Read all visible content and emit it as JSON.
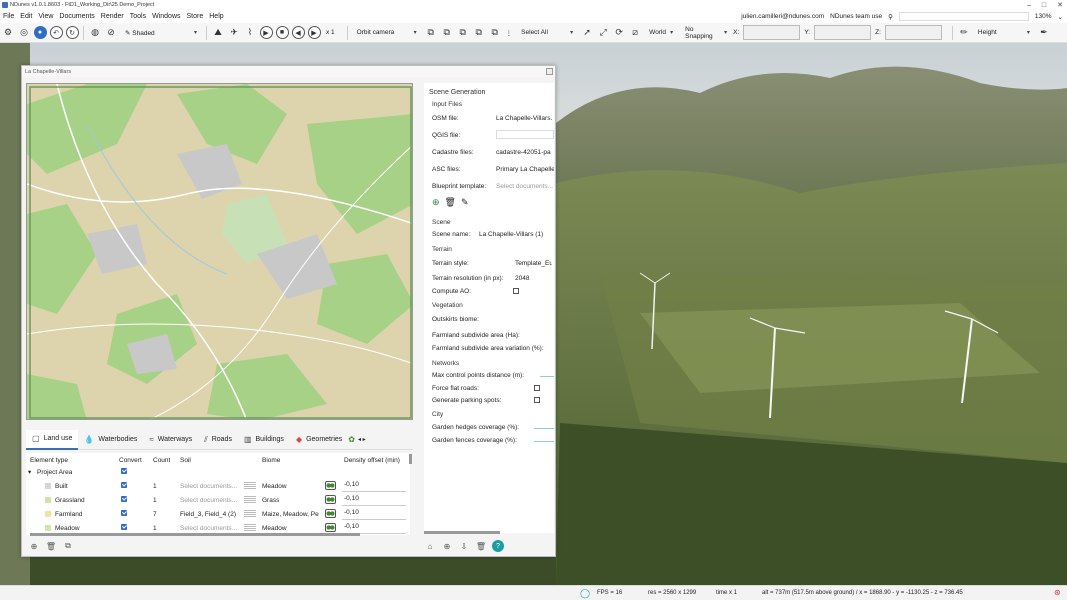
{
  "titlebar": {
    "title": "NDunes v1.0.1.8603 - FtD1_Working_Dir\\25 Demo_Project"
  },
  "menu": {
    "items": [
      "File",
      "Edit",
      "View",
      "Documents",
      "Render",
      "Tools",
      "Windows",
      "Store",
      "Help"
    ],
    "user": "julien.camilleri@ndunes.com",
    "license": "NDunes team use",
    "zoom": "130%"
  },
  "toolbar": {
    "shading": "Shaded",
    "speed": "x 1",
    "camera": "Orbit camera",
    "selection": "Select All",
    "space": "World",
    "snapping": "No Snapping",
    "x_label": "X:",
    "y_label": "Y:",
    "z_label": "Z:",
    "brush": "Height"
  },
  "panel": {
    "title": "La Chapelle-Villars",
    "tabs": [
      "Land use",
      "Waterbodies",
      "Waterways",
      "Roads",
      "Buildings",
      "Geometries"
    ],
    "table": {
      "headers": [
        "Element type",
        "Convert",
        "Count",
        "Soil",
        "Biome",
        "Density offset (min)"
      ],
      "group": "Project Area",
      "rows": [
        {
          "name": "Built",
          "color": "#d6d6d6",
          "count": "1",
          "soil": "Select documents...",
          "biome": "Meadow",
          "density": "-0,10"
        },
        {
          "name": "Grassland",
          "color": "#c9e6a6",
          "count": "1",
          "soil": "Select documents...",
          "biome": "Grass",
          "density": "-0,10"
        },
        {
          "name": "Farmland",
          "color": "#eee4a0",
          "count": "7",
          "soil": "Field_3, Field_4 (2)",
          "biome": "Maize, Meadow, Pe",
          "density": "-0,10"
        },
        {
          "name": "Meadow",
          "color": "#cde9a8",
          "count": "1",
          "soil": "Select documents...",
          "biome": "Meadow",
          "density": "-0,10"
        }
      ]
    }
  },
  "settings": {
    "title": "Scene Generation",
    "input_files": "Input Files",
    "osm_label": "OSM file:",
    "osm_value": "La Chapelle-Villars.",
    "qgis_label": "QGIS file:",
    "cadastre_label": "Cadastre files:",
    "cadastre_value": "cadastre-42051-pa",
    "asc_label": "ASC files:",
    "asc_value": "Primary La Chapelle",
    "blueprint_label": "Blueprint template:",
    "blueprint_placeholder": "Select documents...",
    "scene_head": "Scene",
    "scene_name_label": "Scene name:",
    "scene_name_value": "La Chapelle-Villars (1)",
    "terrain_head": "Terrain",
    "terrain_style_label": "Terrain style:",
    "terrain_style_value": "Template_Eu",
    "terrain_res_label": "Terrain resolution (in px):",
    "terrain_res_value": "2048",
    "ao_label": "Compute AO:",
    "vegetation_head": "Vegetation",
    "outskirts_label": "Outskirts biome:",
    "farmland_area_label": "Farmland subdivide area (Ha):",
    "farmland_var_label": "Farmland subdivide area variation (%):",
    "networks_head": "Networks",
    "max_ctrl_label": "Max control points distance (m):",
    "flat_roads_label": "Force flat roads:",
    "parking_label": "Generate parking spots:",
    "city_head": "City",
    "hedges_label": "Garden hedges coverage (%):",
    "fences_label": "Garden fences coverage (%):"
  },
  "status": {
    "fps": "FPS =   16",
    "res": "res = 2560 x 1299",
    "time": "time x 1",
    "alt": "alt = 737m (517.5m above ground) / x = 1868.90 - y = -1130.25 - z = 736.45"
  },
  "colors": {
    "accent": "#3b6fb5",
    "map_bg": "#ddd4ad",
    "forest": "#a6d186",
    "urban": "#c8c8c8"
  }
}
